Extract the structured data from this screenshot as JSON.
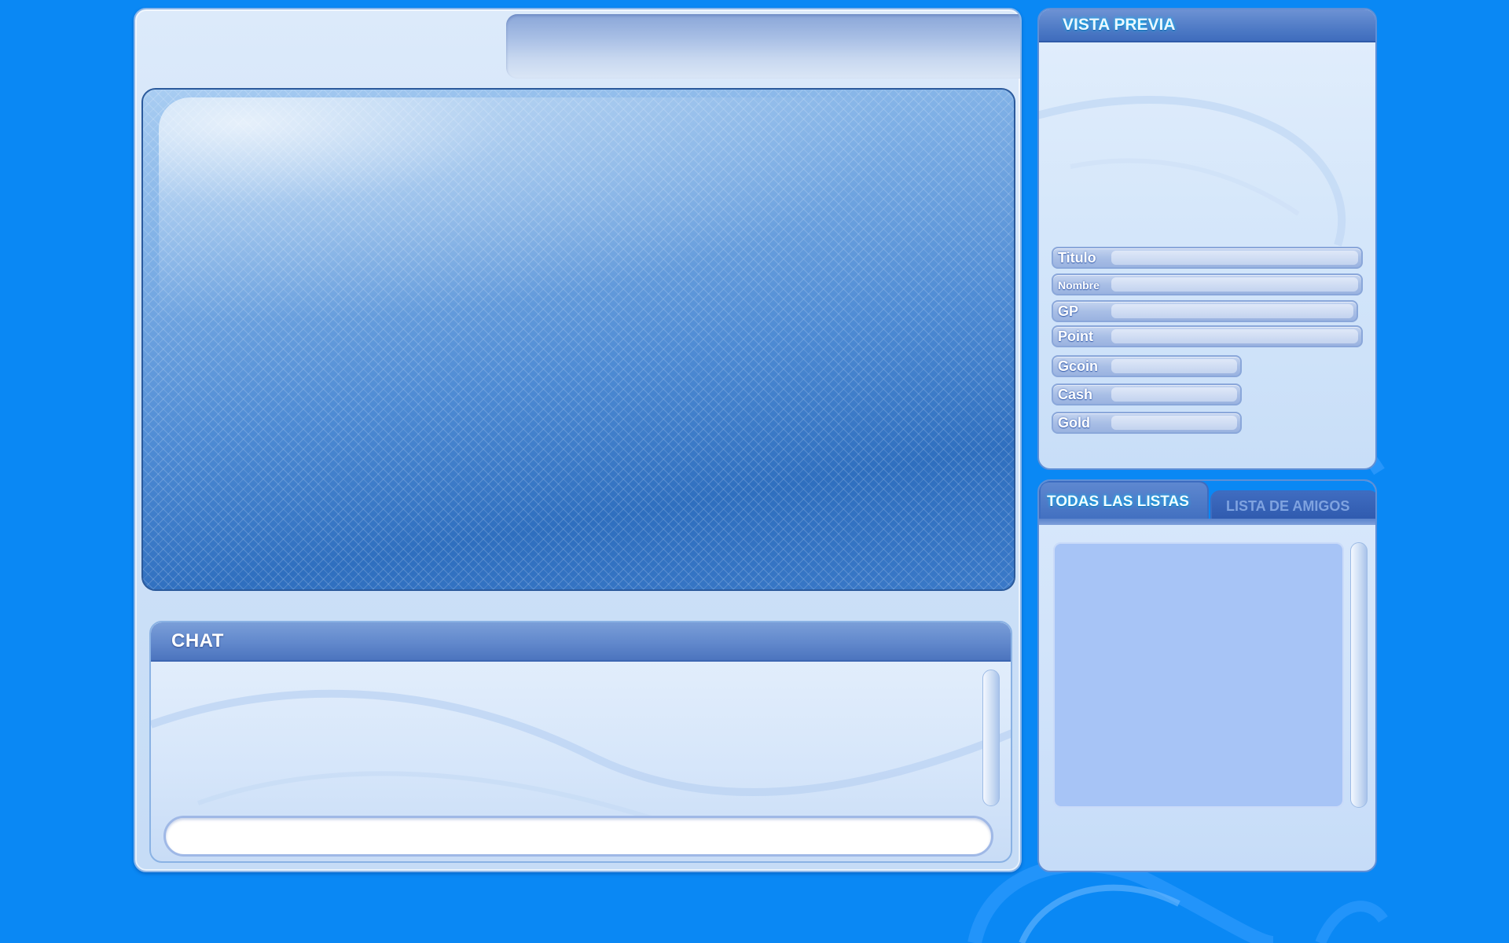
{
  "chat": {
    "title": "CHAT",
    "input_value": ""
  },
  "preview": {
    "title": "VISTA PREVIA",
    "stats": {
      "titulo": {
        "label": "Titulo",
        "value": ""
      },
      "nombre": {
        "label": "Nombre",
        "value": ""
      },
      "gp": {
        "label": "GP",
        "value": ""
      },
      "point": {
        "label": "Point",
        "value": ""
      },
      "gcoin": {
        "label": "Gcoin",
        "value": ""
      },
      "cash": {
        "label": "Cash",
        "value": ""
      },
      "gold": {
        "label": "Gold",
        "value": ""
      }
    }
  },
  "lists": {
    "tab_all": "TODAS LAS LISTAS",
    "tab_friends": "LISTA DE AMIGOS"
  },
  "colors": {
    "background": "#0a88f4",
    "header_blue": "#4f7bc6",
    "list_area": "#a7c4f6"
  }
}
